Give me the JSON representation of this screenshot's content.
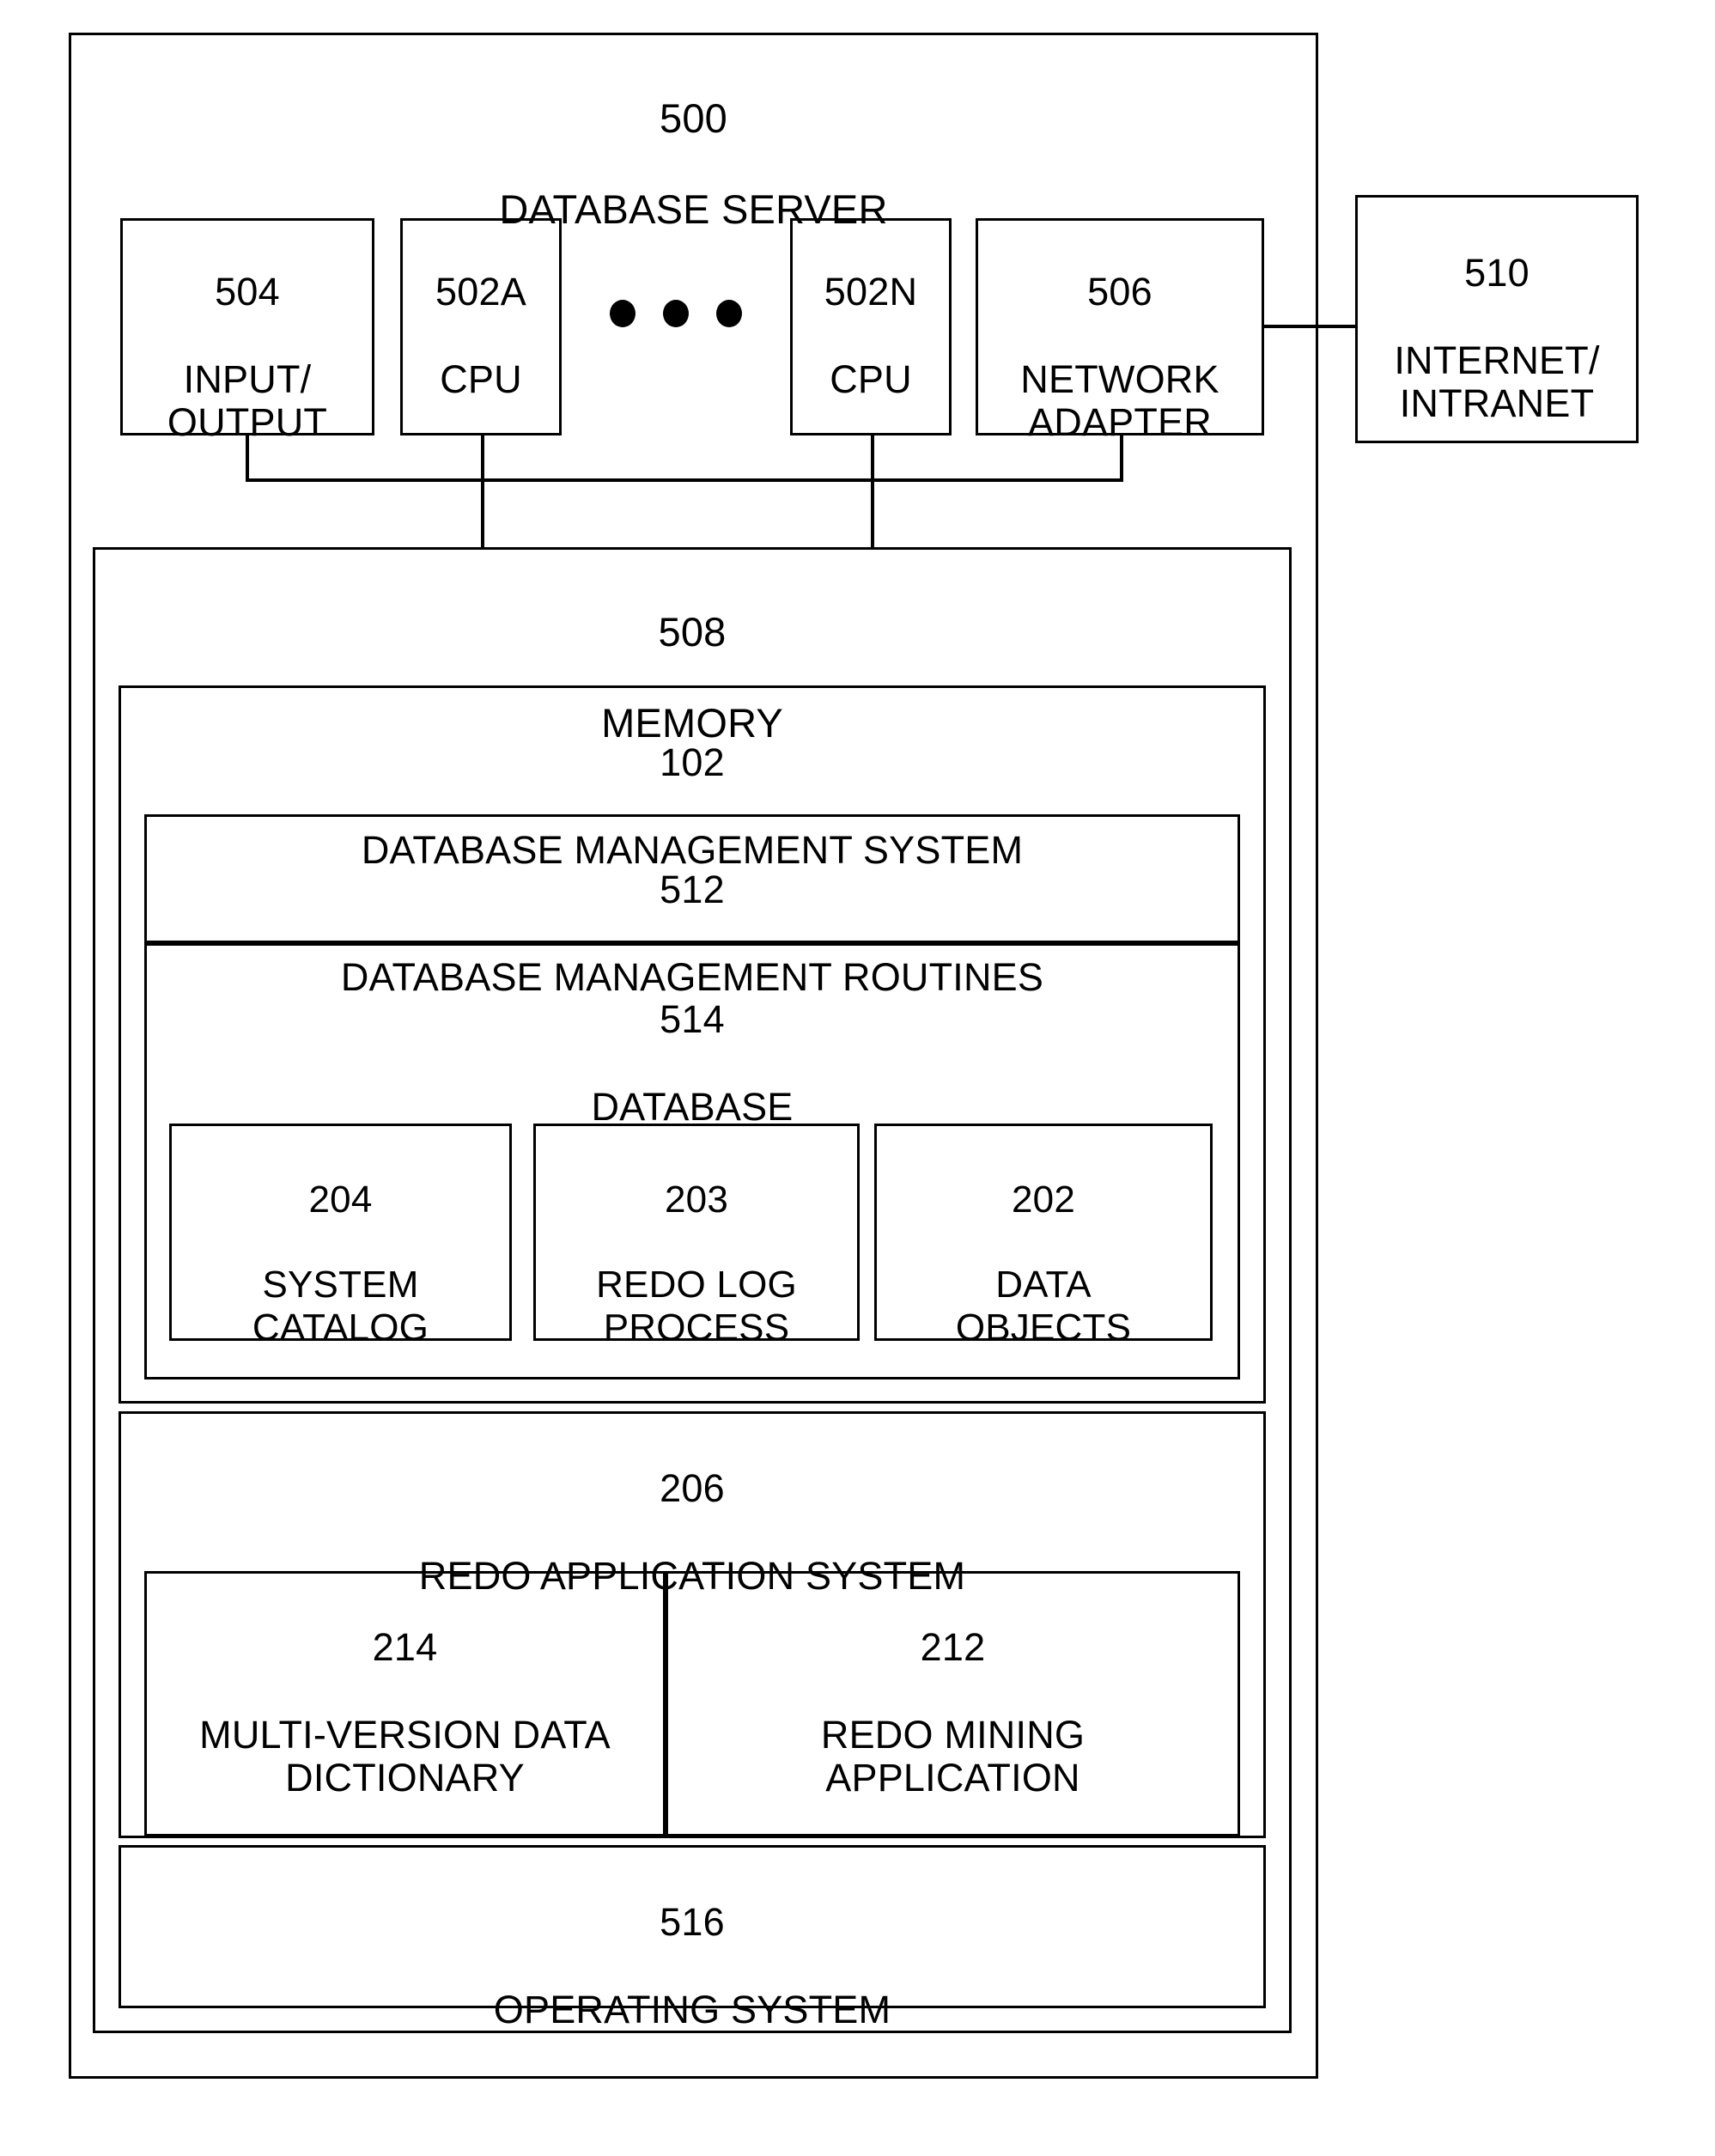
{
  "figure": {
    "server": {
      "number": "500",
      "name": "DATABASE SERVER"
    },
    "io": {
      "number": "504",
      "name": "INPUT/\nOUTPUT"
    },
    "cpu_a": {
      "number": "502A",
      "name": "CPU"
    },
    "ellipsis": "● ● ●",
    "cpu_n": {
      "number": "502N",
      "name": "CPU"
    },
    "network_adapter": {
      "number": "506",
      "name": "NETWORK\nADAPTER"
    },
    "internet": {
      "number": "510",
      "name": "INTERNET/\nINTRANET"
    },
    "memory": {
      "number": "508",
      "name": "MEMORY"
    },
    "dbms": {
      "number": "102",
      "name": "DATABASE MANAGEMENT SYSTEM"
    },
    "db_routines": {
      "number": "512",
      "name": "DATABASE MANAGEMENT ROUTINES"
    },
    "database": {
      "number": "514",
      "name": "DATABASE"
    },
    "system_catalog": {
      "number": "204",
      "name": "SYSTEM\nCATALOG"
    },
    "redo_log_process": {
      "number": "203",
      "name": "REDO  LOG\nPROCESS"
    },
    "data_objects": {
      "number": "202",
      "name": "DATA\nOBJECTS"
    },
    "redo_application_system": {
      "number": "206",
      "name": "REDO APPLICATION SYSTEM"
    },
    "multi_version_dictionary": {
      "number": "214",
      "name": "MULTI-VERSION DATA\nDICTIONARY"
    },
    "redo_mining_application": {
      "number": "212",
      "name": "REDO MINING\nAPPLICATION"
    },
    "operating_system": {
      "number": "516",
      "name": "OPERATING SYSTEM"
    }
  }
}
